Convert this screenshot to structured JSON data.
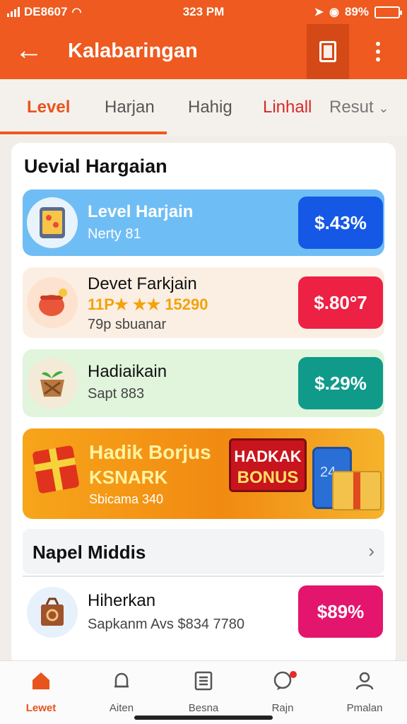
{
  "status": {
    "carrier": "DE8607",
    "time": "323 PM",
    "battery_pct": "89%"
  },
  "appbar": {
    "title": "Kalabaringan"
  },
  "tabs": [
    {
      "label": "Level"
    },
    {
      "label": "Harjan"
    },
    {
      "label": "Hahig"
    },
    {
      "label": "Linhall"
    },
    {
      "label": "Resut"
    }
  ],
  "section": {
    "title": "Uevial Hargaian"
  },
  "rows": [
    {
      "title": "Level Harjain",
      "sub": "Nerty 81",
      "price": "$.43%",
      "icon": "tablet-icon"
    },
    {
      "title": "Devet Farkjain",
      "rating": "11P★ ★★ 15290",
      "sub": "79p sbuanar",
      "price": "$.80°7",
      "icon": "pot-icon"
    },
    {
      "title": "Hadiaikain",
      "sub": "Sapt 883",
      "price": "$.29%",
      "icon": "basket-icon"
    }
  ],
  "banner": {
    "title": "Hadik Borjus",
    "subtitle": "KSNARK",
    "caption": "Sbicama 340",
    "badge_line1": "HADKAK",
    "badge_line2": "BONUS"
  },
  "section2": {
    "title": "Napel Middis"
  },
  "row4": {
    "title": "Hiherkan",
    "sub": "Sapkanm Avs $834 7780",
    "price": "$89%",
    "icon": "parcel-icon"
  },
  "nav": [
    {
      "label": "Lewet",
      "icon": "home-icon"
    },
    {
      "label": "Aiten",
      "icon": "bell-icon"
    },
    {
      "label": "Besna",
      "icon": "list-icon"
    },
    {
      "label": "Rajn",
      "icon": "chat-icon"
    },
    {
      "label": "Pmalan",
      "icon": "user-icon"
    }
  ],
  "colors": {
    "brand": "#ee5a1f",
    "row1": "#6fbdf5",
    "price1": "#1558e6",
    "price2": "#ec2143",
    "price3": "#0f9a8a",
    "price4": "#e3156d"
  }
}
